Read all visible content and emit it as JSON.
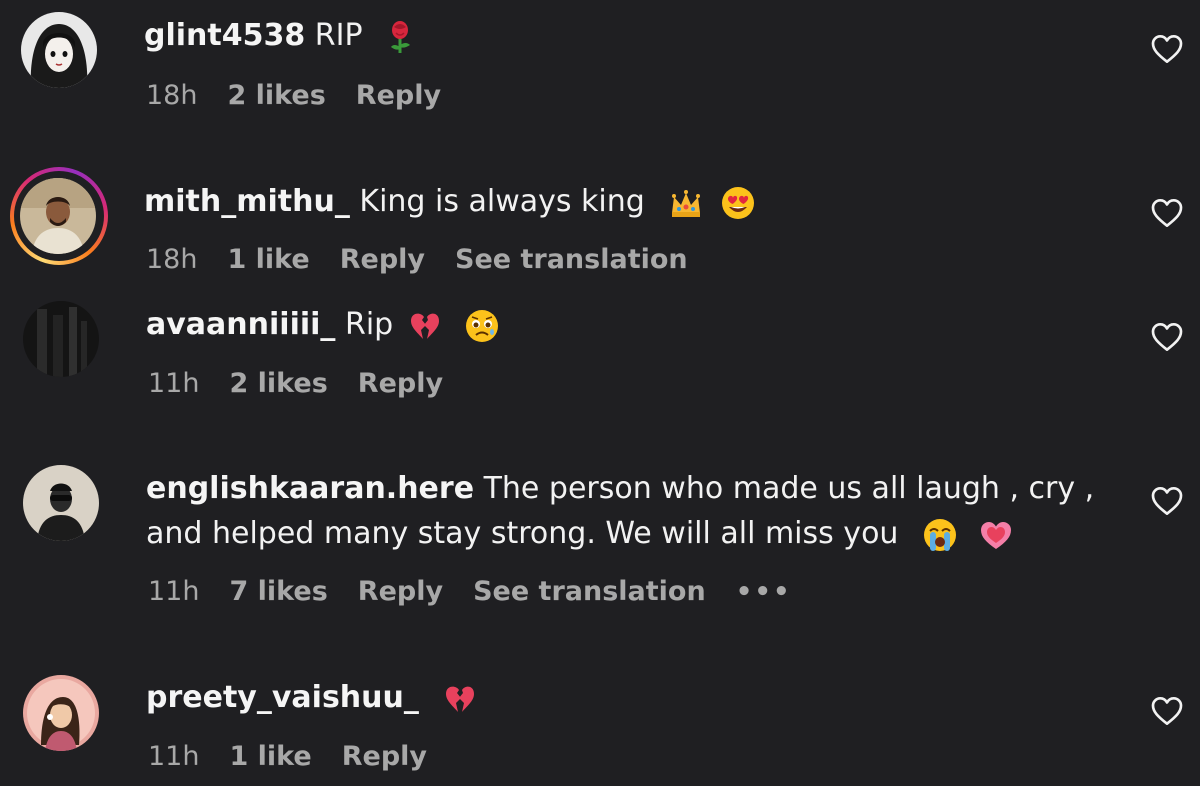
{
  "comments": [
    {
      "username": "glint4538",
      "text": "RIP",
      "emojis": [
        "rose-emoji"
      ],
      "time": "18h",
      "likes": "2 likes",
      "reply": "Reply",
      "translation": null,
      "more": null,
      "liked": false
    },
    {
      "username": "mith_mithu_",
      "text": "King is always king",
      "emojis": [
        "crown-emoji",
        "heart-eyes-emoji"
      ],
      "time": "18h",
      "likes": "1 like",
      "reply": "Reply",
      "translation": "See translation",
      "more": null,
      "liked": false
    },
    {
      "username": "avaanniiiii_",
      "text": "Rip",
      "emojis": [
        "broken-heart-emoji",
        "sad-face-emoji"
      ],
      "time": "11h",
      "likes": "2 likes",
      "reply": "Reply",
      "translation": null,
      "more": null,
      "liked": false
    },
    {
      "username": "englishkaaran.here",
      "text_line1": "The person who made us all laugh , cry ,",
      "text_line2": "and helped many stay strong. We will all miss you",
      "emojis": [
        "crying-face-emoji",
        "growing-heart-emoji"
      ],
      "time": "11h",
      "likes": "7 likes",
      "reply": "Reply",
      "translation": "See translation",
      "more": "•••",
      "liked": false
    },
    {
      "username": "preety_vaishuu_",
      "text": "",
      "emojis": [
        "broken-heart-emoji"
      ],
      "time": "11h",
      "likes": "1 like",
      "reply": "Reply",
      "translation": null,
      "more": null,
      "liked": false
    }
  ],
  "colors": {
    "background": "#1f1f22",
    "primary_text": "#f2f2f2",
    "secondary_text": "#a8a8a8"
  }
}
